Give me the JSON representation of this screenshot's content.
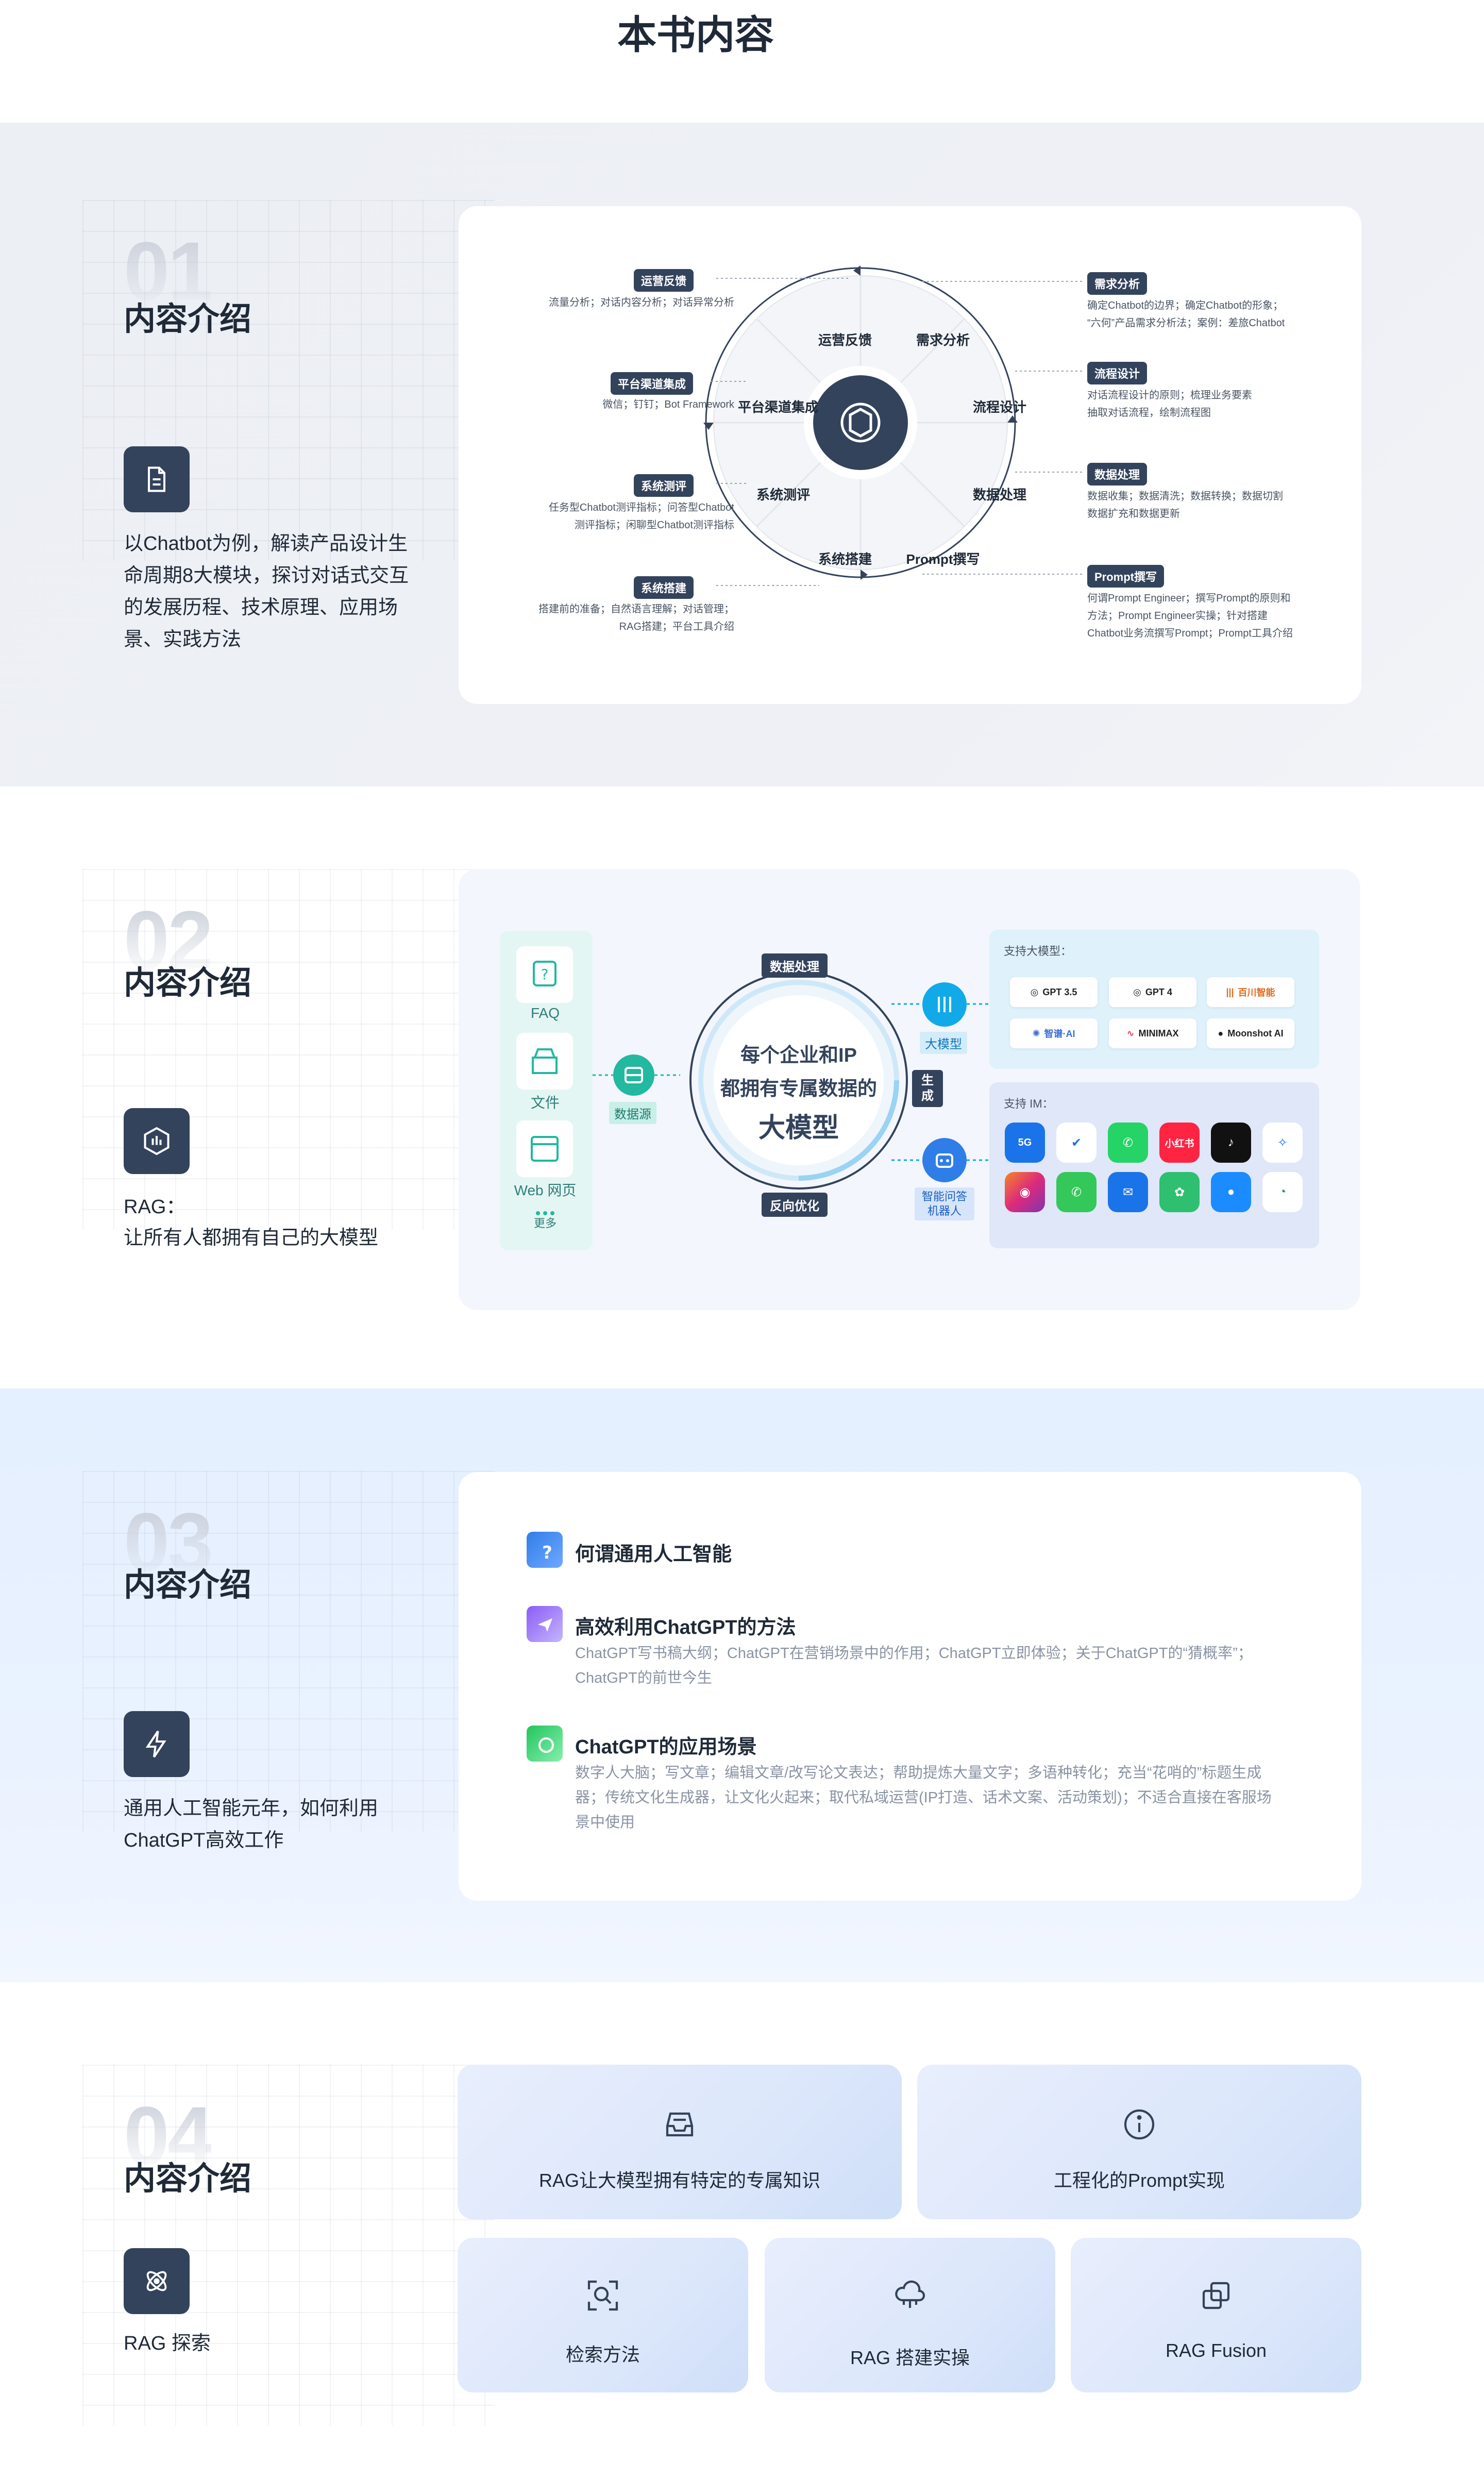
{
  "page_title": "本书内容",
  "sections": [
    {
      "num": "01",
      "title": "内容介绍",
      "icon": "document-icon",
      "desc": "以Chatbot为例，解读产品设计生命周期8大模块，探讨对话式交互的发展历程、技术原理、应用场景、实践方法"
    },
    {
      "num": "02",
      "title": "内容介绍",
      "icon": "chart-icon",
      "desc_line1": "RAG：",
      "desc_line2": "让所有人都拥有自己的大模型"
    },
    {
      "num": "03",
      "title": "内容介绍",
      "icon": "lightning-icon",
      "desc": "通用人工智能元年，如何利用ChatGPT高效工作"
    },
    {
      "num": "04",
      "title": "内容介绍",
      "icon": "atom-icon",
      "desc": "RAG 探索"
    }
  ],
  "wheel": {
    "segments": [
      "运营反馈",
      "需求分析",
      "流程设计",
      "数据处理",
      "Prompt撰写",
      "系统搭建",
      "系统测评",
      "平台渠道集成"
    ],
    "left_notes": [
      {
        "tag": "运营反馈",
        "lines": [
          "流量分析；对话内容分析；对话异常分析"
        ]
      },
      {
        "tag": "平台渠道集成",
        "lines": [
          "微信；钉钉；Bot Framework"
        ]
      },
      {
        "tag": "系统测评",
        "lines": [
          "任务型Chatbot测评指标；问答型Chatbot",
          "测评指标；闲聊型Chatbot测评指标"
        ]
      },
      {
        "tag": "系统搭建",
        "lines": [
          "搭建前的准备；自然语言理解；对话管理；",
          "RAG搭建；平台工具介绍"
        ]
      }
    ],
    "right_notes": [
      {
        "tag": "需求分析",
        "lines": [
          "确定Chatbot的边界；确定Chatbot的形象；",
          "“六何”产品需求分析法；案例：差旅Chatbot"
        ]
      },
      {
        "tag": "流程设计",
        "lines": [
          "对话流程设计的原则；梳理业务要素",
          "抽取对话流程，绘制流程图"
        ]
      },
      {
        "tag": "数据处理",
        "lines": [
          "数据收集；数据清洗；数据转换；数据切割",
          "数据扩充和数据更新"
        ]
      },
      {
        "tag": "Prompt撰写",
        "lines": [
          "何谓Prompt Engineer；撰写Prompt的原则和",
          "方法；Prompt Engineer实操；针对搭建",
          "Chatbot业务流撰写Prompt；Prompt工具介绍"
        ]
      }
    ]
  },
  "rag": {
    "sources": [
      "FAQ",
      "文件",
      "Web 网页",
      "更多"
    ],
    "source_label": "数据源",
    "center_line1": "每个企业和IP",
    "center_line2": "都拥有专属数据的",
    "center_line3": "大模型",
    "top_badge": "数据处理",
    "bottom_badge": "反向优化",
    "side_badge": "生成",
    "model_label": "大模型",
    "bot_label_1": "智能问答",
    "bot_label_2": "机器人",
    "models_title": "支持大模型：",
    "models": [
      "GPT 3.5",
      "GPT 4",
      "百川智能",
      "智谱·AI",
      "MINIMAX",
      "Moonshot AI"
    ],
    "im_title": "支持 IM：",
    "im_apps": [
      "5G",
      "飞书",
      "WhatsApp",
      "小红书",
      "抖音",
      "Messenger",
      "Instagram",
      "电话",
      "邮件",
      "企业微信",
      "iMessage",
      "Google Chat"
    ]
  },
  "features": [
    {
      "title": "何谓通用人工智能",
      "desc": ""
    },
    {
      "title": "高效利用ChatGPT的方法",
      "desc": "ChatGPT写书稿大纲；ChatGPT在营销场景中的作用；ChatGPT立即体验；关于ChatGPT的“猜概率”；ChatGPT的前世今生"
    },
    {
      "title": "ChatGPT的应用场景",
      "desc": "数字人大脑；写文章；编辑文章/改写论文表达；帮助提炼大量文字；多语种转化；充当“花哨的”标题生成器；传统文化生成器，让文化火起来；取代私域运营(IP打造、话术文案、活动策划)；不适合直接在客服场景中使用"
    }
  ],
  "tiles": [
    "RAG让大模型拥有特定的专属知识",
    "工程化的Prompt实现",
    "检索方法",
    "RAG 搭建实操",
    "RAG Fusion"
  ],
  "colors": {
    "dark": "#34435c",
    "teal": "#23b8a0",
    "blue": "#2f7ee8",
    "light_bg": "#eef0f4"
  }
}
